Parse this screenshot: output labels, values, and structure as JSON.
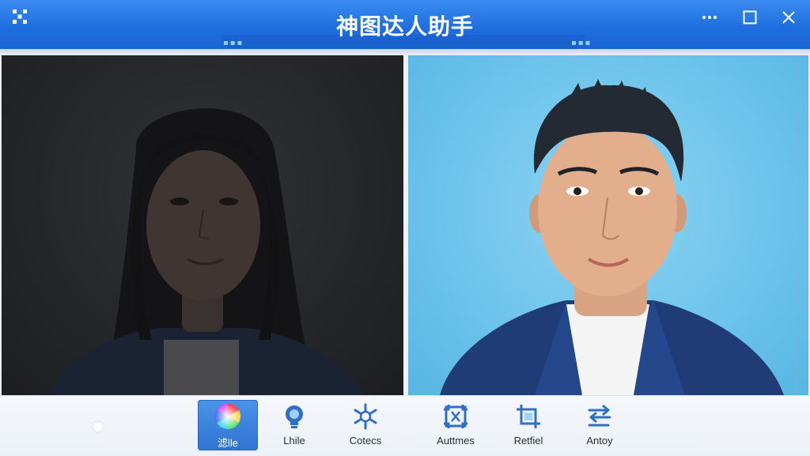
{
  "window": {
    "title": "神图达人助手",
    "controls": [
      "more",
      "maximize",
      "close"
    ]
  },
  "colors": {
    "titlebar": "#1f6fe0",
    "accent": "#2f74d1",
    "right_background": "#6cc3eb"
  },
  "panels": {
    "left": {
      "content": "portrait-dark"
    },
    "right": {
      "content": "portrait-blue"
    }
  },
  "toolbar": {
    "items": [
      {
        "label": "滤lle",
        "icon": "color-wheel-icon",
        "active": true
      },
      {
        "label": "Lhile",
        "icon": "bulb-icon",
        "active": false
      },
      {
        "label": "Cotecs",
        "icon": "snowflake-icon",
        "active": false
      },
      {
        "label": "Auttmes",
        "icon": "crop-frame-icon",
        "active": false
      },
      {
        "label": "Retfiel",
        "icon": "crop-icon",
        "active": false
      },
      {
        "label": "Antoy",
        "icon": "swap-arrows-icon",
        "active": false
      }
    ]
  }
}
